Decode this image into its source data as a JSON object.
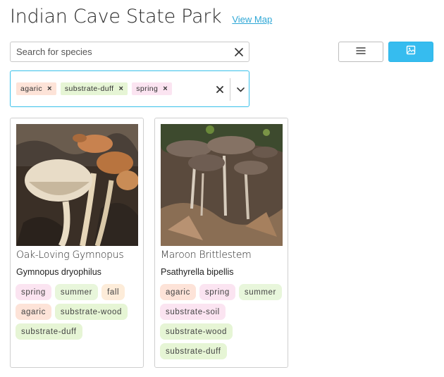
{
  "header": {
    "title": "Indian Cave State Park",
    "view_map_label": "View Map"
  },
  "search": {
    "placeholder": "Search for species",
    "value": ""
  },
  "icons": {
    "clear": "close-icon",
    "list_view": "list-icon",
    "grid_view": "image-icon",
    "dropdown": "chevron-down-icon"
  },
  "filter": {
    "chips": [
      {
        "label": "agaric",
        "color": "#fde3d8"
      },
      {
        "label": "substrate-duff",
        "color": "#e6f5d5"
      },
      {
        "label": "spring",
        "color": "#fbe4f1"
      }
    ]
  },
  "colors": {
    "accent": "#36bcef",
    "agaric": "#fde3d8",
    "spring": "#fbe4f1",
    "summer": "#e8f6db",
    "fall": "#fdecd9",
    "substrate": "#e6f5d5"
  },
  "cards": [
    {
      "common_name": "Oak-Loving Gymnopus",
      "scientific_name": "Gymnopus dryophilus",
      "tags": [
        {
          "label": "spring",
          "color": "#fbe4f1"
        },
        {
          "label": "summer",
          "color": "#e8f6db"
        },
        {
          "label": "fall",
          "color": "#fdecd9"
        },
        {
          "label": "agaric",
          "color": "#fde3d8"
        },
        {
          "label": "substrate-wood",
          "color": "#e6f5d5"
        },
        {
          "label": "substrate-duff",
          "color": "#e6f5d5"
        }
      ]
    },
    {
      "common_name": "Maroon Brittlestem",
      "scientific_name": "Psathyrella bipellis",
      "tags": [
        {
          "label": "agaric",
          "color": "#fde3d8"
        },
        {
          "label": "spring",
          "color": "#fbe4f1"
        },
        {
          "label": "summer",
          "color": "#e8f6db"
        },
        {
          "label": "substrate-soil",
          "color": "#fbe4f1"
        },
        {
          "label": "substrate-wood",
          "color": "#e6f5d5"
        },
        {
          "label": "substrate-duff",
          "color": "#e6f5d5"
        }
      ]
    }
  ]
}
